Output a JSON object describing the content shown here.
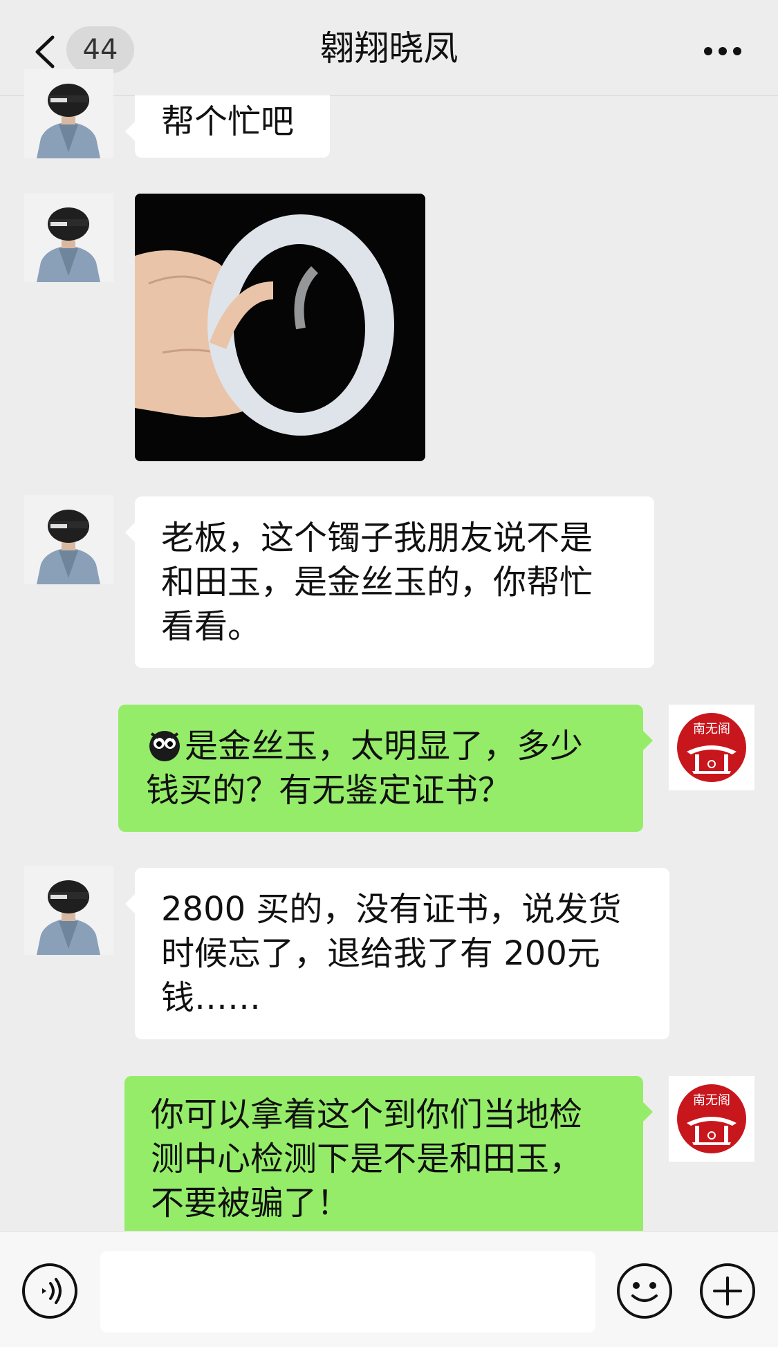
{
  "header": {
    "back_count": "44",
    "title": "翱翔晓凤",
    "icons": [
      "back-chevron-icon",
      "more-icon"
    ]
  },
  "messages": [
    {
      "side": "left",
      "type": "text",
      "text": "帮个忙吧"
    },
    {
      "side": "left",
      "type": "image",
      "image_desc": "jade-bangle-photo"
    },
    {
      "side": "left",
      "type": "text",
      "line1": "老板，这个镯子我朋友说不是",
      "line2": "和田玉，是金丝玉的，你帮忙",
      "line3": "看看。"
    },
    {
      "side": "right",
      "type": "text",
      "line1": "是金丝玉，太明显了，多少",
      "line2": "钱买的？有无鉴定证书？"
    },
    {
      "side": "left",
      "type": "text",
      "line1": "2800 买的，没有证书，说发货",
      "line2": "时候忘了，退给我了有 200元",
      "line3": "钱……"
    },
    {
      "side": "right",
      "type": "text",
      "line1": "你可以拿着这个到你们当地检",
      "line2": "测中心检测下是不是和田玉，",
      "line3": "不要被骗了！"
    }
  ],
  "right_avatar": {
    "text": "南无阁"
  },
  "bottom": {
    "input_value": "",
    "icons": [
      "voice-icon",
      "emoji-icon",
      "plus-icon"
    ]
  },
  "colors": {
    "background": "#ededed",
    "bubble_green": "#95ec69",
    "bubble_white": "#ffffff",
    "avatar_red": "#c8161d"
  }
}
